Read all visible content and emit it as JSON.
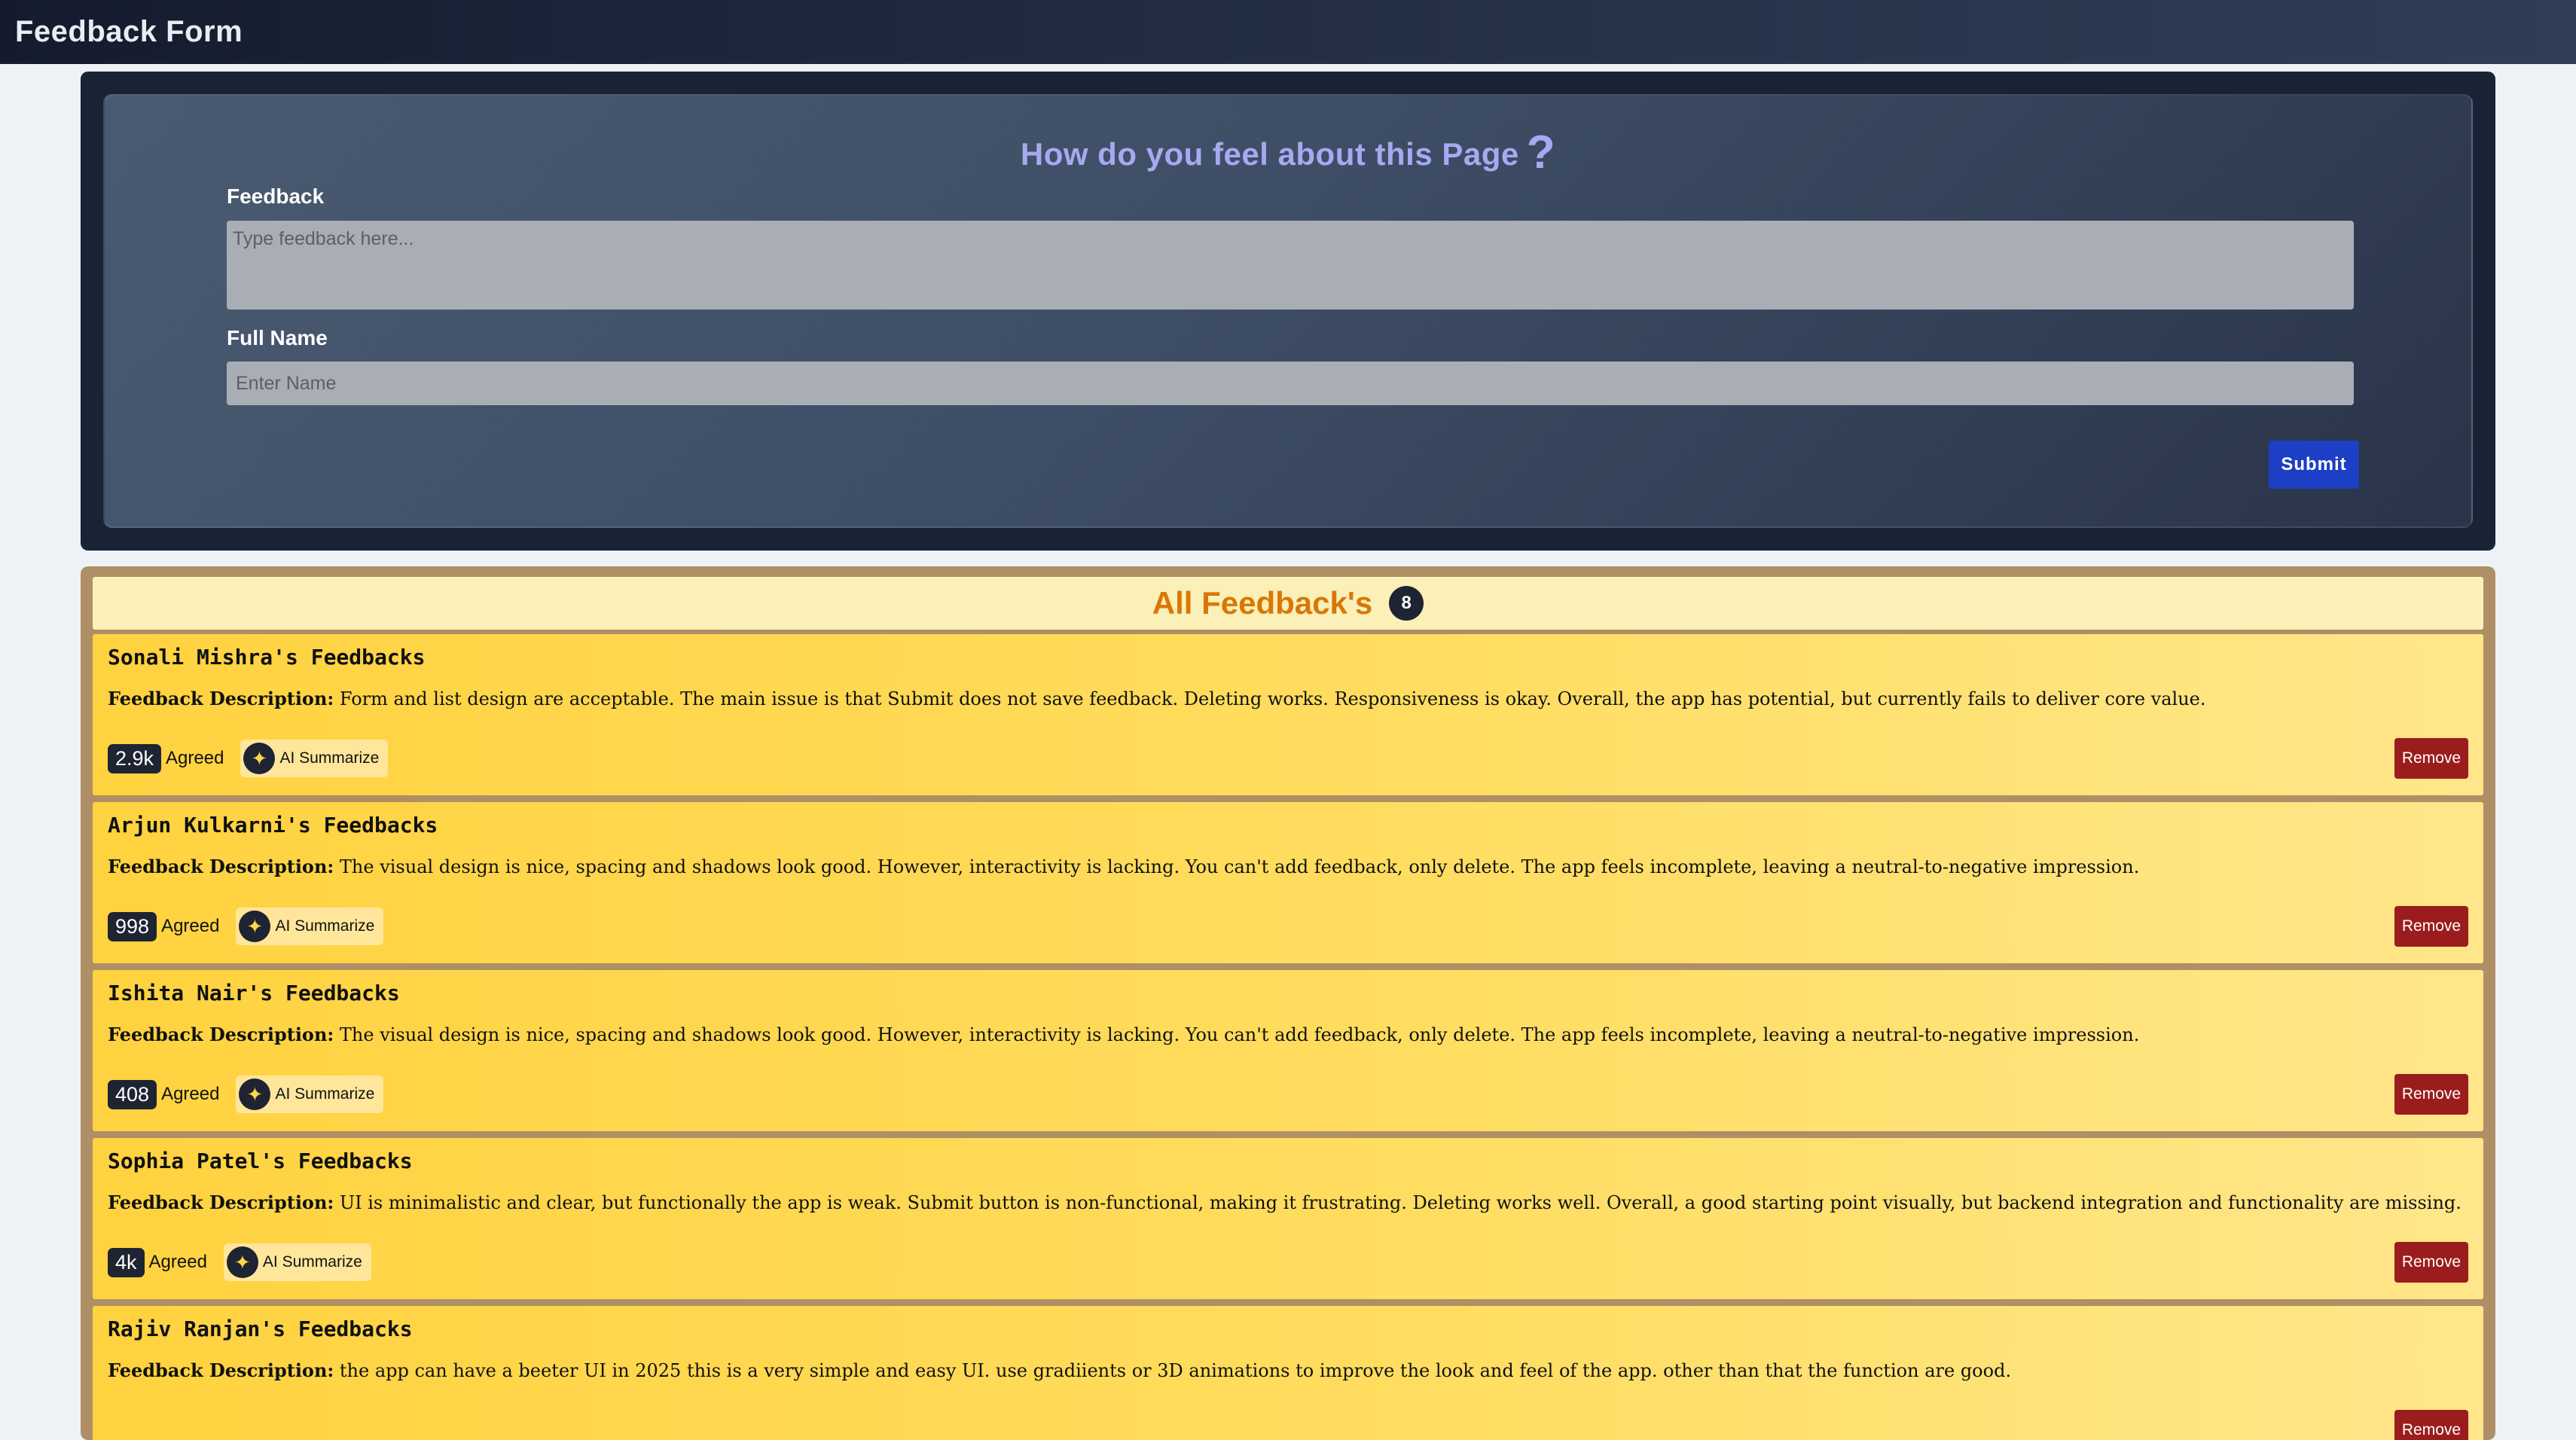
{
  "app": {
    "title": "Feedback Form"
  },
  "form": {
    "heading": "How do you feel about this Page",
    "heading_mark": "?",
    "feedback_label": "Feedback",
    "feedback_placeholder": "Type feedback here...",
    "name_label": "Full Name",
    "name_placeholder": "Enter Name",
    "submit_label": "Submit"
  },
  "list": {
    "title": "All Feedback's",
    "count": "8",
    "desc_label": "Feedback Description:",
    "agreed_label": "Agreed",
    "ai_label": "AI Summarize",
    "remove_label": "Remove",
    "items": [
      {
        "name": "Sonali Mishra's Feedbacks",
        "description": "Form and list design are acceptable. The main issue is that Submit does not save feedback. Deleting works. Responsiveness is okay. Overall, the app has potential, but currently fails to deliver core value.",
        "agreed": "2.9k"
      },
      {
        "name": "Arjun Kulkarni's Feedbacks",
        "description": "The visual design is nice, spacing and shadows look good. However, interactivity is lacking. You can't add feedback, only delete. The app feels incomplete, leaving a neutral-to-negative impression.",
        "agreed": "998"
      },
      {
        "name": "Ishita Nair's Feedbacks",
        "description": "The visual design is nice, spacing and shadows look good. However, interactivity is lacking. You can't add feedback, only delete. The app feels incomplete, leaving a neutral-to-negative impression.",
        "agreed": "408"
      },
      {
        "name": "Sophia Patel's Feedbacks",
        "description": "UI is minimalistic and clear, but functionally the app is weak. Submit button is non-functional, making it frustrating. Deleting works well. Overall, a good starting point visually, but backend integration and functionality are missing.",
        "agreed": "4k"
      },
      {
        "name": "Rajiv Ranjan's Feedbacks",
        "description": "the app can have a beeter UI in 2025 this is a very simple and easy UI. use gradiients or 3D animations to improve the look and feel of the app. other than that the function are good.",
        "agreed": ""
      }
    ]
  },
  "icons": {
    "sparkle": "sparkle-icon",
    "help": "question-mark"
  },
  "colors": {
    "header_bg": "#1b2438",
    "heading_text": "#a7a9f0",
    "submit_bg": "#1d3fc5",
    "list_title": "#d97706",
    "card_bg": "#ffd23f",
    "remove_bg": "#9b1c1c"
  }
}
